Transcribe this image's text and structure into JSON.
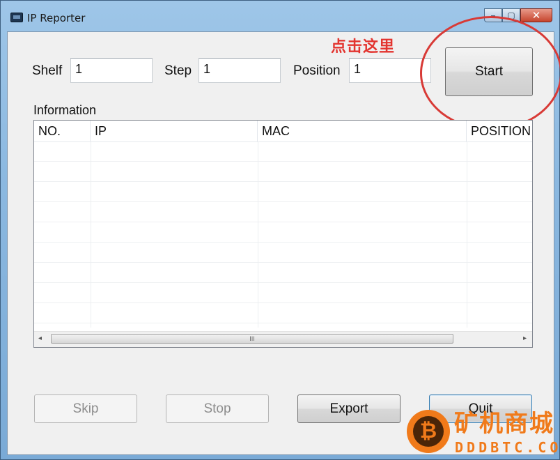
{
  "window": {
    "title": "IP Reporter",
    "controls": {
      "minimize": "–",
      "maximize": "▢",
      "close": "✕"
    }
  },
  "form": {
    "shelf": {
      "label": "Shelf",
      "value": "1"
    },
    "step": {
      "label": "Step",
      "value": "1"
    },
    "position": {
      "label": "Position",
      "value": "1"
    }
  },
  "annotation": {
    "text": "点击这里",
    "color": "#e3342f"
  },
  "buttons": {
    "start": "Start",
    "skip": "Skip",
    "stop": "Stop",
    "export": "Export",
    "quit": "Quit"
  },
  "information": {
    "label": "Information",
    "columns": [
      "NO.",
      "IP",
      "MAC",
      "POSITION"
    ],
    "rows": []
  },
  "scrollbar": {
    "left_arrow": "◂",
    "right_arrow": "▸",
    "grip": "III"
  },
  "watermark": {
    "logo_glyph": "₿",
    "brand": "矿机商城",
    "sub": "DDDBTC.COM",
    "color": "#f07a1a"
  }
}
